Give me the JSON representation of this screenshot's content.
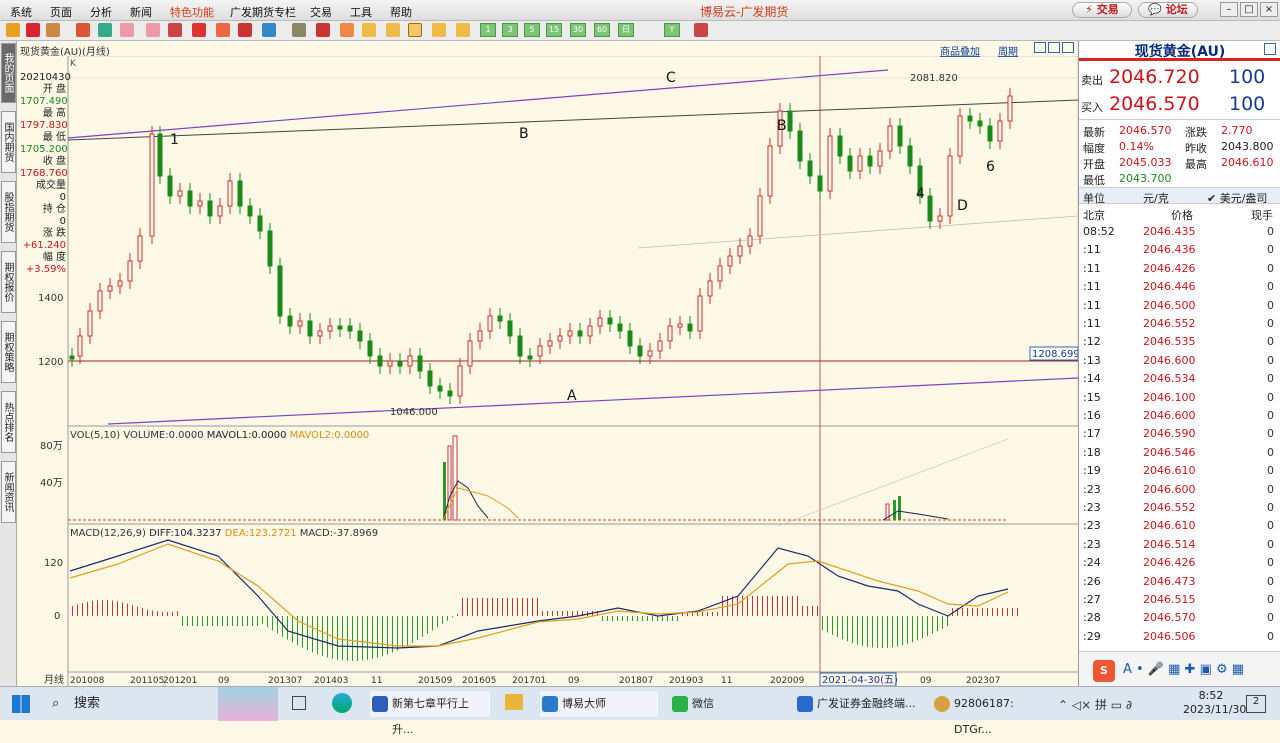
{
  "menu": {
    "items": [
      "系统",
      "页面",
      "分析",
      "新闻",
      "特色功能",
      "广发期货专栏",
      "交易",
      "工具",
      "帮助"
    ],
    "app_title": "博易云-广发期货",
    "trade_btn": "交易",
    "forum_btn": "论坛"
  },
  "toolbar": {
    "period_buttons": [
      "1",
      "3",
      "5",
      "15",
      "30",
      "60",
      "日",
      "Y"
    ]
  },
  "left_tabs": [
    "我的页面",
    "国内期货",
    "股指期货",
    "期权报价",
    "期权策略",
    "热点排名",
    "新闻资讯"
  ],
  "chart": {
    "instrument_label": "现货黄金(AU)(月线)",
    "k_label": "K",
    "links": {
      "overlay": "商品叠加",
      "period": "周期"
    },
    "info": {
      "date": "20210430",
      "open_label": "开 盘",
      "open": "1707.490",
      "high_label": "最 高",
      "high": "1797.830",
      "low_label": "最 低",
      "low": "1705.200",
      "close_label": "收 盘",
      "close": "1768.760",
      "volume_label": "成交量",
      "volume": "0",
      "oi_label": "持 仓",
      "oi": "0",
      "change_label": "涨 跌",
      "change": "+61.240",
      "pct_label": "幅 度",
      "pct": "+3.59%"
    },
    "price_ticks": [
      "1400",
      "1200"
    ],
    "price_label_right": "1208.699",
    "annotations": {
      "peak": "2081.820",
      "low": "1046.000",
      "C": "C",
      "B": "B",
      "A": "A",
      "D": "D",
      "n1": "1",
      "n4": "4",
      "n6": "6",
      "B2": "B"
    },
    "volume_legend": {
      "prefix": "VOL(5,10) VOLUME:0.0000",
      "mavol1": "MAVOL1:0.0000",
      "mavol2": "MAVOL2:0.0000"
    },
    "volume_ticks": [
      "80万",
      "40万"
    ],
    "macd_legend": {
      "prefix": "MACD(12,26,9)",
      "diff": "DIFF:104.3237",
      "dea": "DEA:123.2721",
      "macd": "MACD:-37.8969"
    },
    "macd_ticks": [
      "120",
      "0"
    ],
    "x_axis_label": "月线",
    "x_ticks": [
      "201008",
      "201105",
      "201201",
      "09",
      "201307",
      "201403",
      "11",
      "201509",
      "201605",
      "201701",
      "09",
      "201807",
      "201903",
      "11",
      "202009",
      "09",
      "202307"
    ],
    "cursor_date": "2021-04-30(五)"
  },
  "right_panel": {
    "title": "现货黄金(AU)",
    "sell_label": "卖出",
    "sell_price": "2046.720",
    "sell_vol": "100",
    "buy_label": "买入",
    "buy_price": "2046.570",
    "buy_vol": "100",
    "stats": [
      {
        "l1": "最新",
        "v1": "2046.570",
        "l2": "涨跌",
        "v2": "2.770"
      },
      {
        "l1": "幅度",
        "v1": "0.14%",
        "l2": "昨收",
        "v2": "2043.800"
      },
      {
        "l1": "开盘",
        "v1": "2045.033",
        "l2": "最高",
        "v2": "2046.610"
      },
      {
        "l1": "最低",
        "v1": "2043.700",
        "l2": "",
        "v2": ""
      }
    ],
    "unit_label": "单位",
    "unit_value": "元/克",
    "unit_alt": "美元/盎司",
    "cols": {
      "time": "北京",
      "price": "价格",
      "vol": "现手"
    },
    "ticks": [
      {
        "t": "08:52",
        "p": "2046.435",
        "v": "0"
      },
      {
        "t": ":11",
        "p": "2046.436",
        "v": "0"
      },
      {
        "t": ":11",
        "p": "2046.426",
        "v": "0"
      },
      {
        "t": ":11",
        "p": "2046.446",
        "v": "0"
      },
      {
        "t": ":11",
        "p": "2046.500",
        "v": "0"
      },
      {
        "t": ":11",
        "p": "2046.552",
        "v": "0"
      },
      {
        "t": ":12",
        "p": "2046.535",
        "v": "0"
      },
      {
        "t": ":13",
        "p": "2046.600",
        "v": "0"
      },
      {
        "t": ":14",
        "p": "2046.534",
        "v": "0"
      },
      {
        "t": ":15",
        "p": "2046.100",
        "v": "0"
      },
      {
        "t": ":16",
        "p": "2046.600",
        "v": "0"
      },
      {
        "t": ":17",
        "p": "2046.590",
        "v": "0"
      },
      {
        "t": ":18",
        "p": "2046.546",
        "v": "0"
      },
      {
        "t": ":19",
        "p": "2046.610",
        "v": "0"
      },
      {
        "t": ":23",
        "p": "2046.600",
        "v": "0"
      },
      {
        "t": ":23",
        "p": "2046.552",
        "v": "0"
      },
      {
        "t": ":23",
        "p": "2046.610",
        "v": "0"
      },
      {
        "t": ":23",
        "p": "2046.514",
        "v": "0"
      },
      {
        "t": ":24",
        "p": "2046.426",
        "v": "0"
      },
      {
        "t": ":26",
        "p": "2046.473",
        "v": "0"
      },
      {
        "t": ":27",
        "p": "2046.515",
        "v": "0"
      },
      {
        "t": ":28",
        "p": "2046.570",
        "v": "0"
      },
      {
        "t": ":29",
        "p": "2046.506",
        "v": "0"
      }
    ]
  },
  "taskbar": {
    "search": "搜索",
    "apps": [
      "新第七章平行上升...",
      "博易大师",
      "微信",
      "广发证券金融终端...",
      "92806187: DTGr..."
    ],
    "time": "8:52",
    "date": "2023/11/30",
    "notif": "2"
  }
}
